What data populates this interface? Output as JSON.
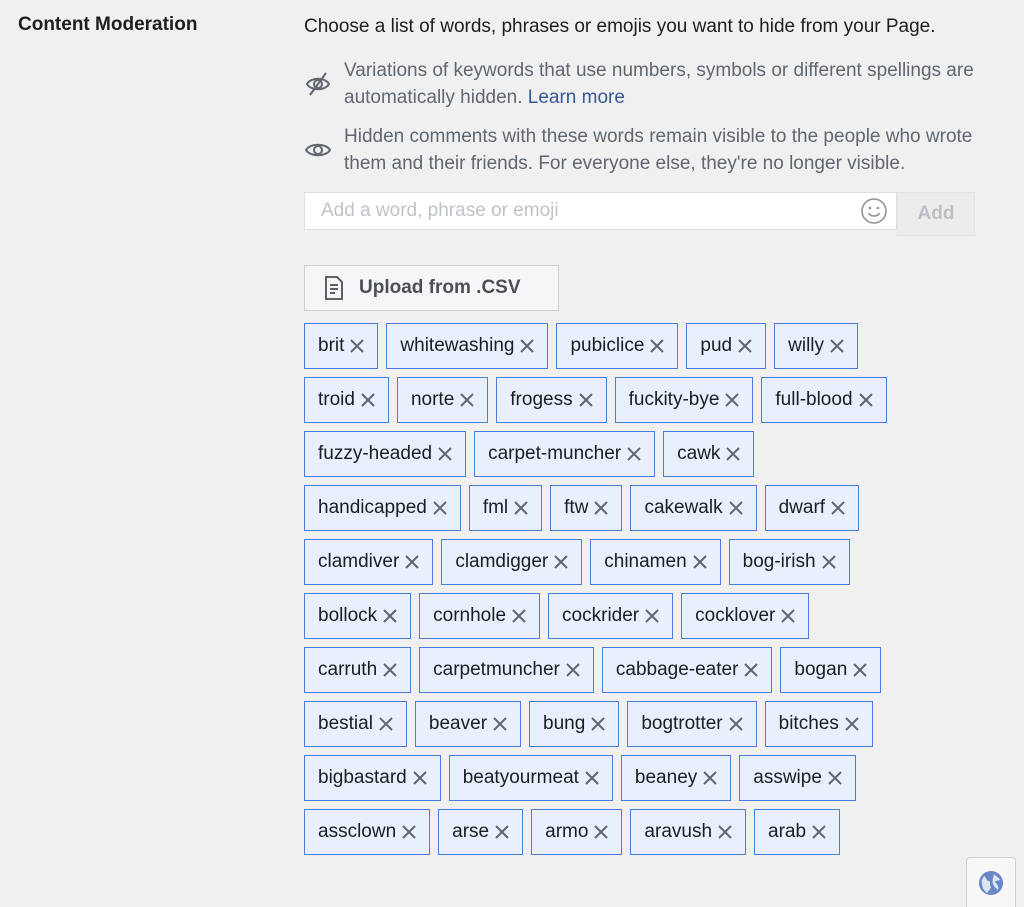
{
  "section": {
    "title": "Content Moderation"
  },
  "intro": "Choose a list of words, phrases or emojis you want to hide from your Page.",
  "info": [
    {
      "icon": "eye-slash-icon",
      "text": "Variations of keywords that use numbers, symbols or different spellings are automatically hidden.",
      "link": "Learn more"
    },
    {
      "icon": "eye-icon",
      "text": "Hidden comments with these words remain visible to the people who wrote them and their friends. For everyone else, they're no longer visible."
    }
  ],
  "input": {
    "placeholder": "Add a word, phrase or emoji",
    "value": "",
    "emoji_icon": "smiley-icon",
    "add_label": "Add"
  },
  "upload": {
    "label": "Upload from .CSV",
    "icon": "document-icon"
  },
  "tags": [
    [
      "brit",
      "whitewashing",
      "pubiclice",
      "pud",
      "willy"
    ],
    [
      "troid",
      "norte",
      "frogess",
      "fuckity-bye",
      "full-blood"
    ],
    [
      "fuzzy-headed",
      "carpet-muncher",
      "cawk"
    ],
    [
      "handicapped",
      "fml",
      "ftw",
      "cakewalk",
      "dwarf"
    ],
    [
      "clamdiver",
      "clamdigger",
      "chinamen",
      "bog-irish"
    ],
    [
      "bollock",
      "cornhole",
      "cockrider",
      "cocklover"
    ],
    [
      "carruth",
      "carpetmuncher",
      "cabbage-eater",
      "bogan"
    ],
    [
      "bestial",
      "beaver",
      "bung",
      "bogtrotter",
      "bitches"
    ],
    [
      "bigbastard",
      "beatyourmeat",
      "beaney",
      "asswipe"
    ],
    [
      "assclown",
      "arse",
      "armo",
      "aravush",
      "arab"
    ]
  ],
  "footer": {
    "icon": "globe-icon"
  }
}
